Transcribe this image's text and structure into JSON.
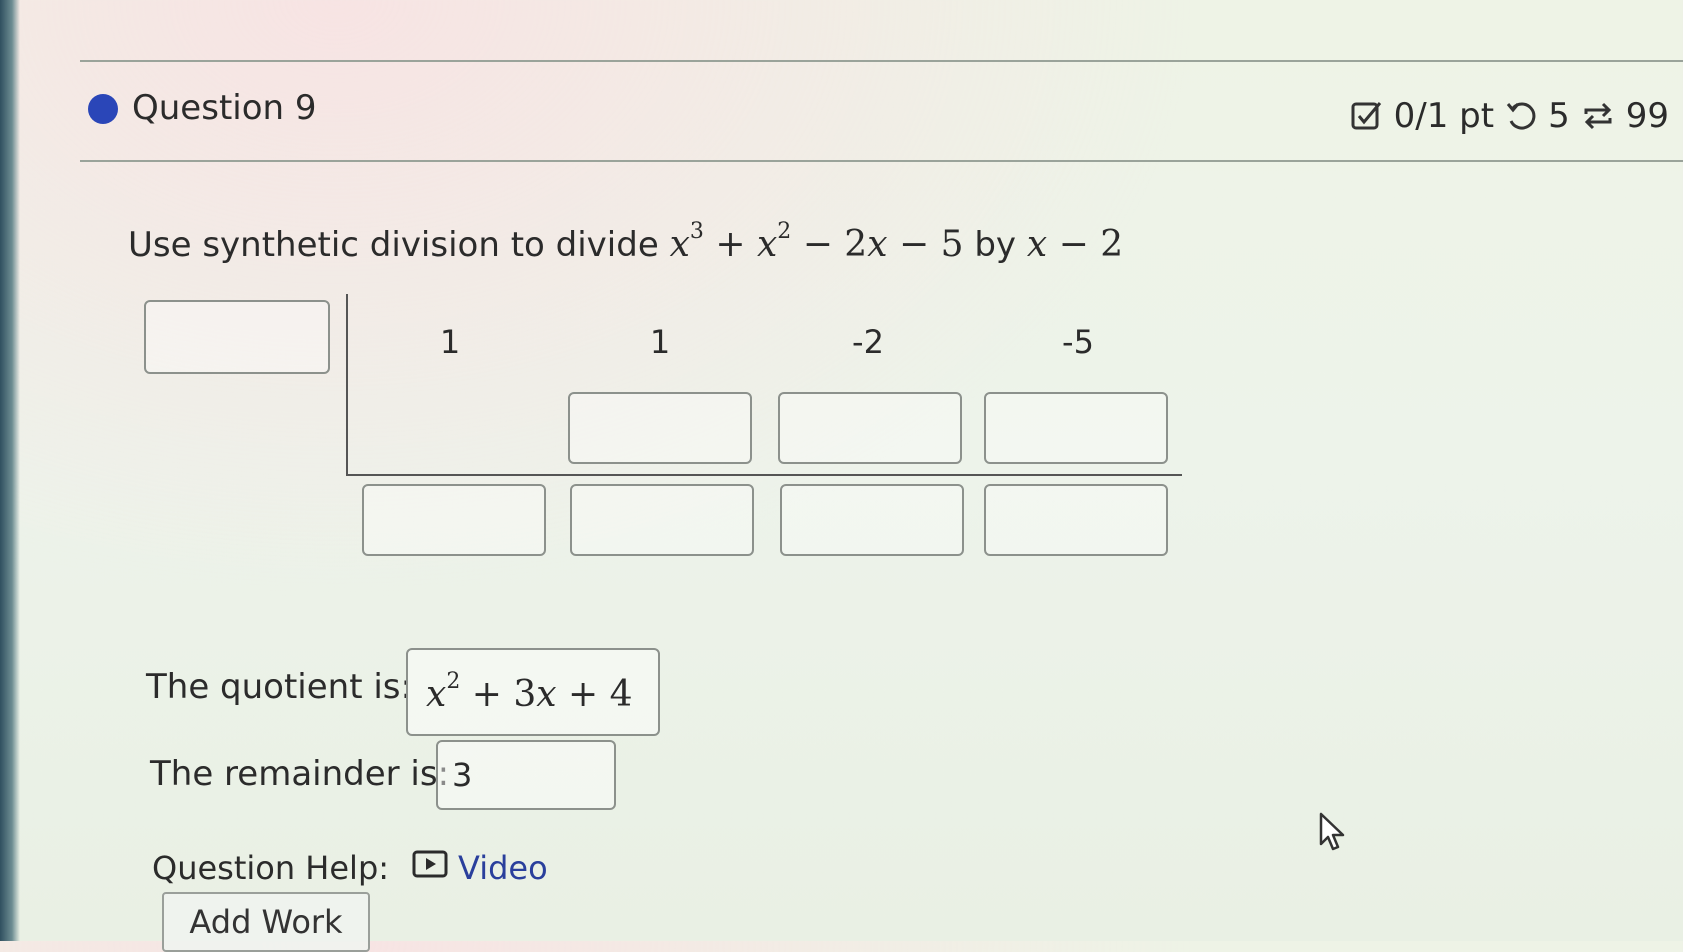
{
  "question": {
    "title": "Question 9",
    "score": "0/1 pt",
    "retries": "5",
    "attempts": "99"
  },
  "prompt": {
    "lead": "Use synthetic division to divide",
    "joiner": "by"
  },
  "synthetic": {
    "coefficients": [
      "1",
      "1",
      "-2",
      "-5"
    ]
  },
  "answers": {
    "quotient_label": "The quotient is:",
    "remainder_label": "The remainder is:",
    "remainder_value": "3"
  },
  "help": {
    "label": "Question Help:",
    "video": "Video"
  },
  "actions": {
    "add_work": "Add Work"
  },
  "icons": {
    "status": "status-dot-icon",
    "score": "checkbox-edit-icon",
    "retries": "undo-icon",
    "attempts": "repeat-icon",
    "video": "play-video-icon",
    "cursor": "mouse-pointer-icon"
  },
  "colors": {
    "status_dot": "#2a46b8",
    "link": "#2a3f9c"
  }
}
